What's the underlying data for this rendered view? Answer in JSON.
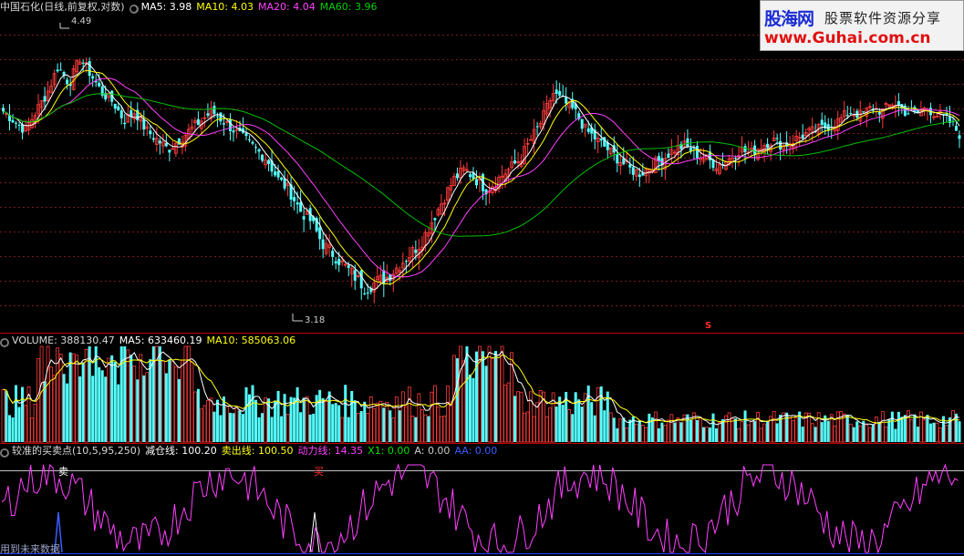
{
  "price_header": {
    "stock": "中国石化(日线,前复权,对数)",
    "ma5": "MA5: 3.98",
    "ma10": "MA10: 4.03",
    "ma20": "MA20: 4.04",
    "ma60": "MA60: 3.96"
  },
  "volume_header": {
    "name": "VOLUME: 388130.47",
    "ma5": "MA5: 633460.19",
    "ma10": "MA10: 585063.06"
  },
  "indicator_header": {
    "name": "较准的买卖点(10,5,95,250)",
    "reduce": "减仓线: 100.20",
    "sell": "卖出线: 100.50",
    "power": "动力线: 14.35",
    "x1": "X1: 0.00",
    "a": "A: 0.00",
    "aa": "AA: 0.00"
  },
  "watermark": {
    "logo": "股海网",
    "slogan": "股票软件资源分享",
    "url": "www.Guhai.com.cn"
  },
  "price_labels": {
    "high": "4.49",
    "low": "3.18",
    "signal": "S"
  },
  "indicator_labels": {
    "sell_mark": "卖",
    "buy_mark": "买"
  },
  "footer_note": "用到未来数据",
  "colors": {
    "up": "#ff3c3c",
    "down": "#54ffff",
    "ma5": "#ffffff",
    "ma10": "#ffff00",
    "ma20": "#ff40ff",
    "ma60": "#00c000",
    "power": "#ff40ff",
    "indicator_blue": "#3a5cff"
  },
  "chart_data": [
    {
      "type": "candlestick",
      "title": "中国石化(日线,前复权,对数)",
      "high_label": 4.49,
      "low_label": 3.18,
      "ylim": [
        3.1,
        4.6
      ],
      "close": [
        4.1,
        4.05,
        4.0,
        4.1,
        4.2,
        4.35,
        4.25,
        4.4,
        4.3,
        4.2,
        4.15,
        4.05,
        4.1,
        4.0,
        3.95,
        3.9,
        3.95,
        4.0,
        4.05,
        4.1,
        4.05,
        4.0,
        3.95,
        3.9,
        3.85,
        3.75,
        3.7,
        3.6,
        3.55,
        3.45,
        3.4,
        3.35,
        3.3,
        3.25,
        3.28,
        3.3,
        3.35,
        3.4,
        3.45,
        3.55,
        3.65,
        3.75,
        3.8,
        3.75,
        3.7,
        3.75,
        3.8,
        3.85,
        3.95,
        4.05,
        4.2,
        4.15,
        4.1,
        4.0,
        3.95,
        3.9,
        3.85,
        3.8,
        3.78,
        3.82,
        3.85,
        3.9,
        3.92,
        3.88,
        3.85,
        3.82,
        3.85,
        3.9,
        3.88,
        3.92,
        3.95,
        3.92,
        3.95,
        3.98,
        4.0,
        4.02,
        4.05,
        4.1,
        4.08,
        4.12,
        4.1,
        4.15,
        4.1,
        4.08,
        4.12,
        4.08,
        4.05,
        3.98
      ]
    },
    {
      "type": "bar",
      "title": "VOLUME",
      "volume": 388130.47,
      "ma5": 633460.19,
      "ma10": 585063.06
    },
    {
      "type": "line",
      "title": "较准的买卖点(10,5,95,250)",
      "reduce_line": 100.2,
      "sell_line": 100.5,
      "power_line": 14.35,
      "x1": 0.0,
      "a": 0.0,
      "aa": 0.0
    }
  ]
}
